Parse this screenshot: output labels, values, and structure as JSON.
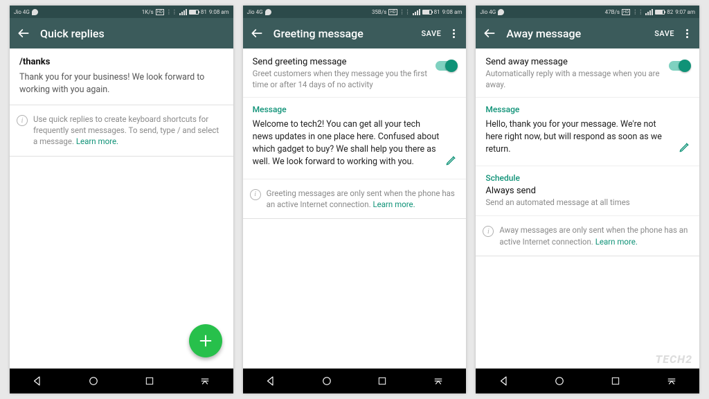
{
  "screens": [
    {
      "status": {
        "carrier": "Jio 4G",
        "speed": "1K/s",
        "battery": "81",
        "time": "9:08 am"
      },
      "title": "Quick replies",
      "has_save": false,
      "has_more": false,
      "quick_reply": {
        "shortcut": "/thanks",
        "text": "Thank you for your business! We look forward to working with you again."
      },
      "info": "Use quick replies to create keyboard shortcuts for frequently sent messages. To send, type / and select a message. ",
      "learn_more": "Learn more.",
      "fab": true
    },
    {
      "status": {
        "carrier": "Jio 4G",
        "speed": "35B/s",
        "battery": "81",
        "time": "9:08 am"
      },
      "title": "Greeting message",
      "has_save": true,
      "has_more": true,
      "save_label": "SAVE",
      "toggle": {
        "title": "Send greeting message",
        "sub": "Greet customers when they message you the first time or after 14 days of no activity"
      },
      "message_label": "Message",
      "message_text": "Welcome to tech2! You can get all your tech news updates in one place here. Confused about which gadget to buy? We shall help you there as well. We look forward to working with you.",
      "info": "Greeting messages are only sent when the phone has an active Internet connection. ",
      "learn_more": "Learn more."
    },
    {
      "status": {
        "carrier": "Jio 4G",
        "speed": "47B/s",
        "battery": "82",
        "time": "9:07 am"
      },
      "title": "Away message",
      "has_save": true,
      "has_more": true,
      "save_label": "SAVE",
      "toggle": {
        "title": "Send away message",
        "sub": "Automatically reply with a message when you are away."
      },
      "message_label": "Message",
      "message_text": "Hello, thank you for your message. We're not here right now, but will respond as soon as we return.",
      "schedule_label": "Schedule",
      "schedule": {
        "title": "Always send",
        "sub": "Send an automated message at all times"
      },
      "info": "Away messages are only sent when the phone has an active Internet connection. ",
      "learn_more": "Learn more."
    }
  ],
  "watermark": "TECH2"
}
